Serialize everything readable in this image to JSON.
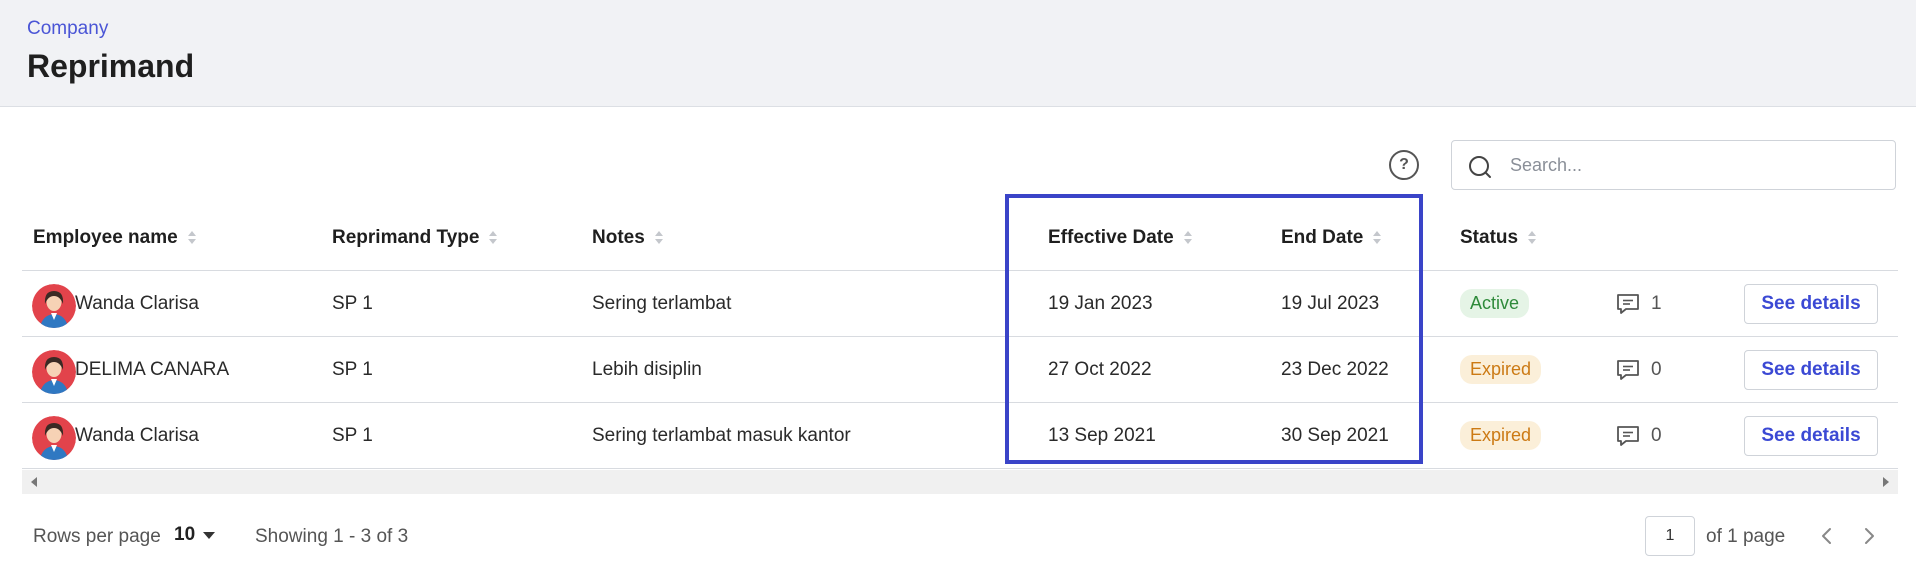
{
  "header": {
    "breadcrumb": "Company",
    "title": "Reprimand"
  },
  "help_icon_glyph": "?",
  "search": {
    "placeholder": "Search...",
    "value": ""
  },
  "table": {
    "columns": [
      "Employee name",
      "Reprimand Type",
      "Notes",
      "Effective Date",
      "End Date",
      "Status"
    ],
    "rows": [
      {
        "employee": "Wanda Clarisa",
        "type": "SP 1",
        "notes": "Sering terlambat",
        "effective": "19 Jan 2023",
        "end": "19 Jul 2023",
        "status": "Active",
        "comments": "1",
        "action": "See details"
      },
      {
        "employee": "DELIMA CANARA",
        "type": "SP 1",
        "notes": "Lebih disiplin",
        "effective": "27 Oct 2022",
        "end": "23 Dec 2022",
        "status": "Expired",
        "comments": "0",
        "action": "See details"
      },
      {
        "employee": "Wanda Clarisa",
        "type": "SP 1",
        "notes": "Sering terlambat masuk kantor",
        "effective": "13 Sep 2021",
        "end": "30 Sep 2021",
        "status": "Expired",
        "comments": "0",
        "action": "See details"
      }
    ]
  },
  "footer": {
    "rows_per_page_label": "Rows per page",
    "rows_per_page_value": "10",
    "showing": "Showing 1 - 3 of 3",
    "page_value": "1",
    "of_page": "of 1 page"
  },
  "colors": {
    "accent": "#3b49d4",
    "highlight": "#3a44c8",
    "active_badge": "#2e8a3a",
    "expired_badge": "#cc7a14"
  }
}
